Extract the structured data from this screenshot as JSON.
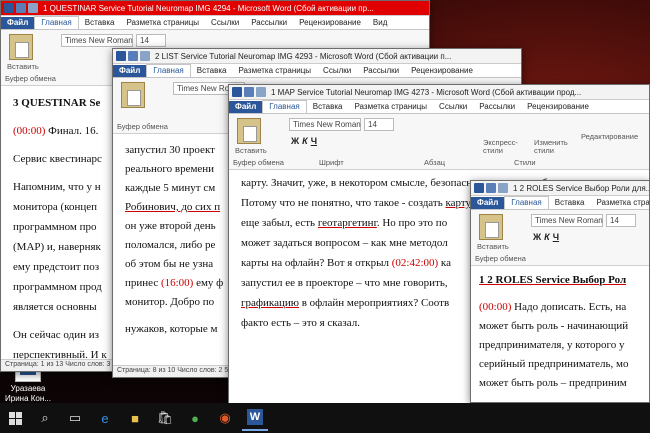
{
  "desktop": {
    "icon_label_line1": "Уразаева",
    "icon_label_line2": "Ирина Кон..."
  },
  "common": {
    "tab_file": "Файл",
    "tab_home": "Главная",
    "tab_insert": "Вставка",
    "tab_layout": "Разметка страницы",
    "tab_refs": "Ссылки",
    "tab_mail": "Рассылки",
    "tab_review": "Рецензирование",
    "tab_view": "Вид",
    "paste": "Вставить",
    "clipboard": "Буфер обмена",
    "font_group": "Шрифт",
    "para_group": "Абзац",
    "styles_group": "Стили",
    "editing_group": "Редактирование",
    "font_name": "Times New Roman",
    "font_size": "14",
    "express_styles": "Экспресс-стили",
    "change_styles": "Изменить стили"
  },
  "win1": {
    "title": "1 QUESTINAR Service Tutorial Neuromap IMG 4294 - Microsoft Word (Сбой активации пр...",
    "heading": "3 QUESTINAR Se",
    "p1_time": "(00:00)",
    "p1_text": " Финал. 16.",
    "p2": "Сервис квестинарс",
    "p3a": "Напомним, что у н",
    "p3b": "монитора (концеп",
    "p3c": "программном про",
    "p3d": "(MAP) и, наверняк",
    "p3e": "ему предстоит поз",
    "p3f": "программном прод",
    "p3g": "является основны",
    "p4a": "Он сейчас один из",
    "p4b": "перспективный. И к",
    "status": "Страница: 1 из 13   Число слов: 3 4"
  },
  "win2": {
    "title": "2 LIST Service Tutorial Neuromap IMG 4293 - Microsoft Word (Сбой активации п...",
    "l1": "запустил 30 проект",
    "l2": "реального времени",
    "l3": "каждые 5 минут см",
    "l4": "Робинович, до сих п",
    "l5": "он уже второй день",
    "l6": "поломался, либо ре",
    "l7": "об этом бы не узна",
    "l8_time": "(16:00)",
    "l8_a": "принес ",
    "l8_b": " ему ф",
    "l9": "монитор. Добро по",
    "l10": "нужаков, которые м",
    "status": "Страница: 8 из 10   Число слов: 2 5"
  },
  "win3": {
    "title": "1 MAP Service Tutorial Neuromap IMG 4273 - Microsoft Word (Сбой активации прод...",
    "l1": "карту. Значит, уже, в некотором смысле, безопасно – это надо добавить.",
    "l2a": "Потому что не понятно, что такое - создать ",
    "l2b": "карту",
    "l3a": "еще забыл, есть ",
    "l3b": "геотаргетинг",
    "l3c": ". Но про это по",
    "l4": "может задаться вопросом – как мне методол",
    "l5_time": "(02:42:00)",
    "l5a": "карты на офлайн? Вот я открыл ",
    "l5b": " ка",
    "l6": "запустил ее в проекторе – что мне говорить,",
    "l7a": "графикацию",
    "l7b": " в офлайн мероприятиях? Соотв",
    "l8": "факто есть – это я сказал."
  },
  "win4": {
    "title": "1 2 ROLES Service Выбор Роли для...",
    "heading": "1 2 ROLES Service Выбор Рол",
    "l1_time": "(00:00)",
    "l1": " Надо дописать. Есть, на",
    "l2": "может быть роль - начинающий",
    "l3": "предпринимателя, у которого у",
    "l4": "серийный предприниматель, мо",
    "l5": "может быть роль – предприним"
  }
}
